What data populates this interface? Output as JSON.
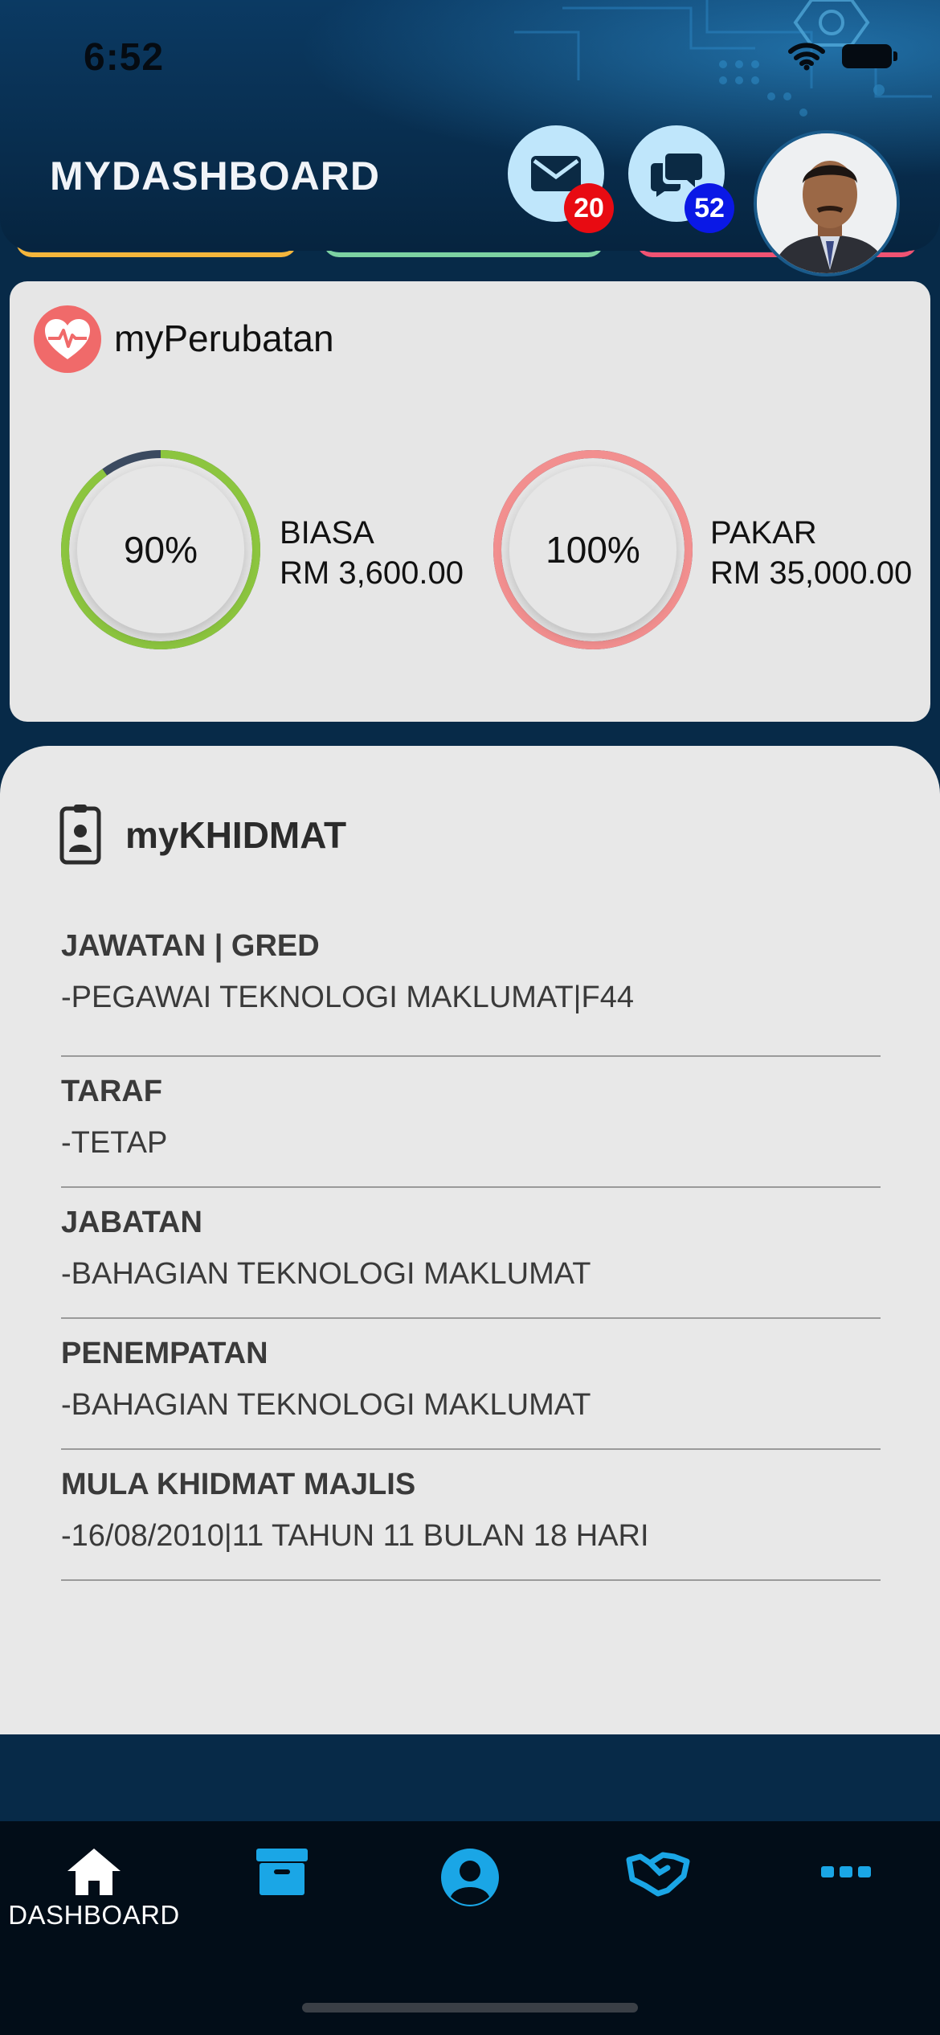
{
  "status_bar": {
    "time": "6:52"
  },
  "header": {
    "title": "MYDASHBOARD",
    "mail_count": "20",
    "chat_count": "52"
  },
  "perubatan": {
    "title": "myPerubatan",
    "items": [
      {
        "percent_label": "90%",
        "fraction": 0.9,
        "type": "BIASA",
        "amount": "RM 3,600.00",
        "color": "#8cc53f"
      },
      {
        "percent_label": "100%",
        "fraction": 1.0,
        "type": "PAKAR",
        "amount": "RM 35,000.00",
        "color": "#f28f8f"
      }
    ]
  },
  "khidmat": {
    "title": "myKHIDMAT",
    "items": [
      {
        "label": "JAWATAN | GRED",
        "value": "-PEGAWAI TEKNOLOGI MAKLUMAT|F44"
      },
      {
        "label": "TARAF",
        "value": "-TETAP"
      },
      {
        "label": "JABATAN",
        "value": "-BAHAGIAN TEKNOLOGI MAKLUMAT"
      },
      {
        "label": "PENEMPATAN",
        "value": "-BAHAGIAN TEKNOLOGI MAKLUMAT"
      },
      {
        "label": "MULA KHIDMAT MAJLIS",
        "value": "-16/08/2010|11 TAHUN 11 BULAN 18 HARI"
      }
    ]
  },
  "tabbar": {
    "dashboard_label": "DASHBOARD",
    "tabs": [
      "home-icon",
      "archive-icon",
      "user-icon",
      "handshake-icon",
      "more-icon"
    ],
    "accent": "#1aa6e6"
  },
  "colors": {
    "background": "#072a48",
    "card": "#e6e6e6",
    "ring_track": "#3b4a60"
  }
}
